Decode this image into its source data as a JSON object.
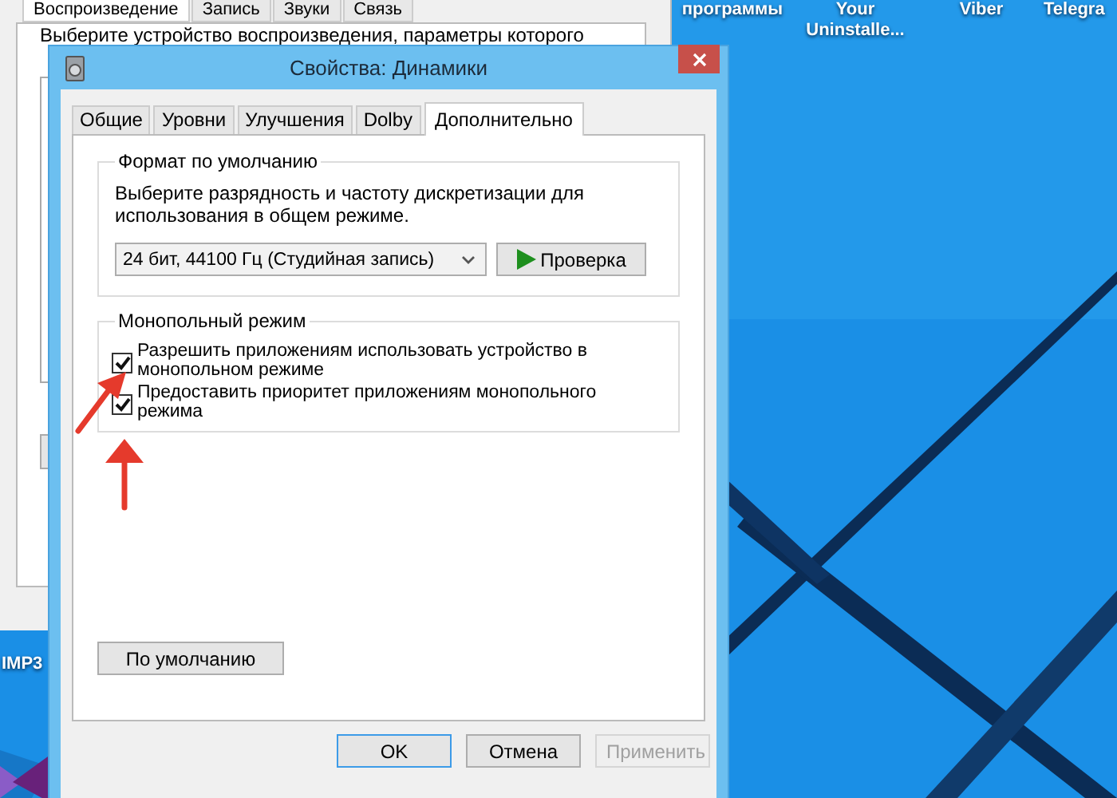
{
  "desktop": {
    "icons": [
      {
        "lines": [
          "программы"
        ]
      },
      {
        "lines": [
          "Your",
          "Uninstalle..."
        ]
      },
      {
        "lines": [
          "Viber"
        ]
      },
      {
        "lines": [
          "Telegra"
        ]
      }
    ],
    "left_icon_label": "IMP3"
  },
  "background_window": {
    "tabs": [
      {
        "label": "Воспроизведение",
        "selected": true
      },
      {
        "label": "Запись",
        "selected": false
      },
      {
        "label": "Звуки",
        "selected": false
      },
      {
        "label": "Связь",
        "selected": false
      }
    ],
    "instruction": "Выберите устройство воспроизведения, параметры которого"
  },
  "dialog": {
    "title": "Свойства: Динамики",
    "tabs": [
      {
        "label": "Общие",
        "selected": false
      },
      {
        "label": "Уровни",
        "selected": false
      },
      {
        "label": "Улучшения",
        "selected": false
      },
      {
        "label": "Dolby",
        "selected": false
      },
      {
        "label": "Дополнительно",
        "selected": true
      }
    ],
    "default_format": {
      "legend": "Формат по умолчанию",
      "description": "Выберите разрядность и частоту дискретизации для использования в общем режиме.",
      "format_select": {
        "value": "24 бит, 44100 Гц (Студийная запись)"
      },
      "test_button": "Проверка"
    },
    "exclusive_mode": {
      "legend": "Монопольный режим",
      "options": [
        {
          "label": "Разрешить приложениям использовать устройство в монопольном режиме",
          "checked": true
        },
        {
          "label": "Предоставить приоритет приложениям монопольного режима",
          "checked": true
        }
      ]
    },
    "restore_defaults_button": "По умолчанию",
    "buttons": [
      {
        "label": "OK",
        "default": true,
        "disabled": false
      },
      {
        "label": "Отмена",
        "default": false,
        "disabled": false
      },
      {
        "label": "Применить",
        "default": false,
        "disabled": true
      }
    ]
  }
}
